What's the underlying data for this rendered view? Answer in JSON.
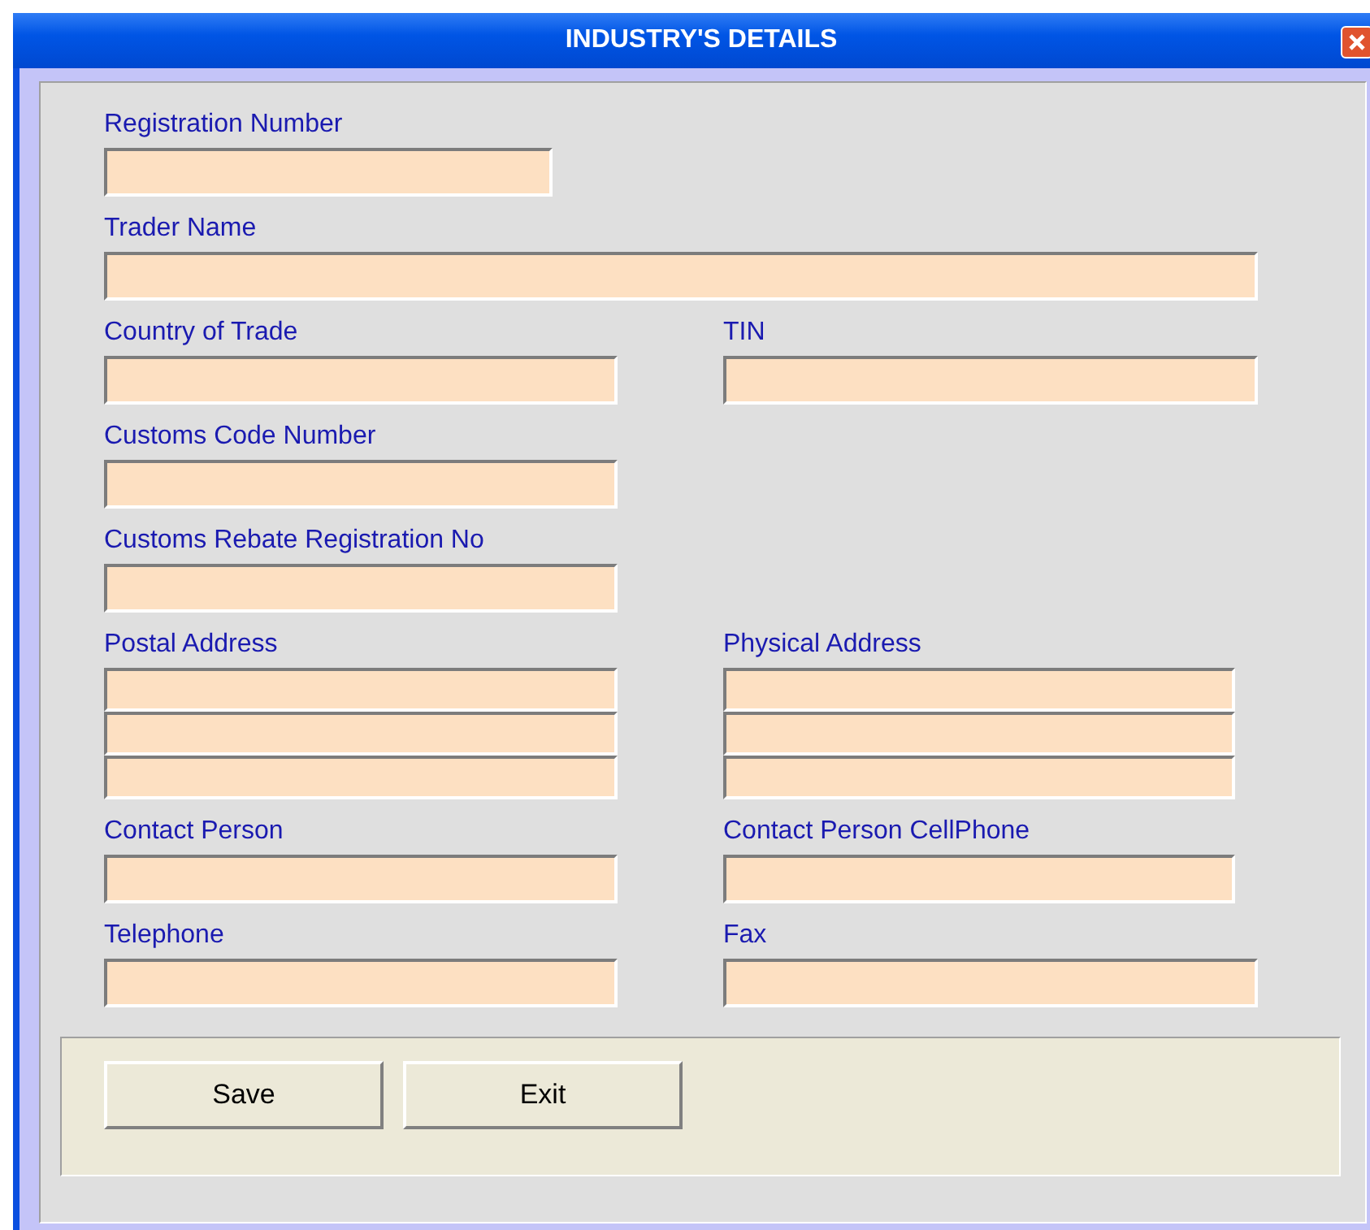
{
  "window": {
    "title": "INDUSTRY'S DETAILS"
  },
  "form_rows": [
    [
      {
        "label": "Registration Number",
        "kind": "single"
      }
    ],
    [
      {
        "label": "Trader Name",
        "kind": "single"
      }
    ],
    [
      {
        "label": "Country of Trade",
        "kind": "single"
      },
      {
        "label": "TIN",
        "kind": "single"
      }
    ],
    [
      {
        "label": "Customs Code Number",
        "kind": "single"
      }
    ],
    [
      {
        "label": "Customs Rebate Registration No",
        "kind": "single"
      }
    ],
    [
      {
        "label": "Postal Address",
        "kind": "multiline"
      },
      {
        "label": "Physical Address",
        "kind": "multiline"
      }
    ],
    [
      {
        "label": "Contact Person",
        "kind": "single"
      },
      {
        "label": "Contact Person CellPhone",
        "kind": "single"
      }
    ],
    [
      {
        "label": "Telephone",
        "kind": "single"
      },
      {
        "label": "Fax",
        "kind": "single"
      }
    ]
  ],
  "buttons": [
    "Save",
    "Exit"
  ]
}
